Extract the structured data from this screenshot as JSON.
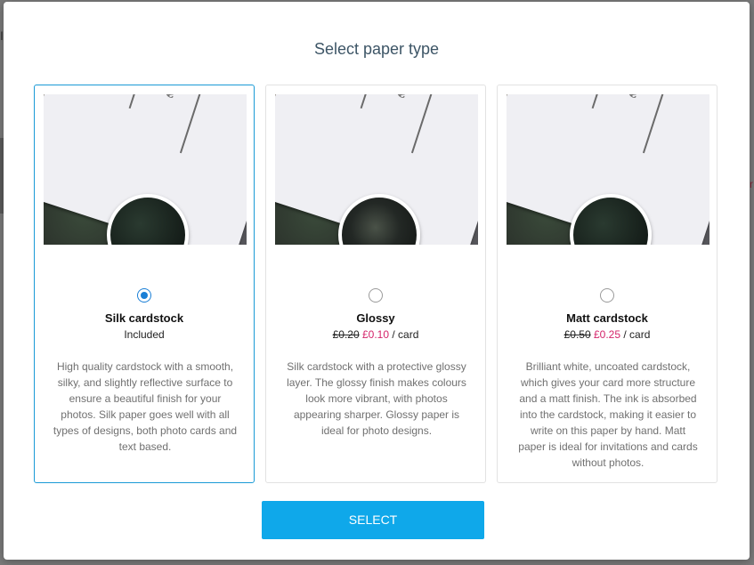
{
  "modal": {
    "title": "Select paper type",
    "select_label": "SELECT"
  },
  "options": [
    {
      "name": "Silk cardstock",
      "price_text": "Included",
      "old_price": "",
      "new_price": "",
      "unit": "",
      "selected": true,
      "description": "High quality cardstock with a smooth, silky, and slightly reflective surface to ensure a beautiful finish for your photos. Silk paper goes well with all types of designs, both photo cards and text based."
    },
    {
      "name": "Glossy",
      "price_text": "",
      "old_price": "£0.20",
      "new_price": "£0.10",
      "unit": "/ card",
      "selected": false,
      "description": "Silk cardstock with a protective glossy layer. The glossy finish makes colours look more vibrant, with photos appearing sharper. Glossy paper is ideal for photo designs."
    },
    {
      "name": "Matt cardstock",
      "price_text": "",
      "old_price": "£0.50",
      "new_price": "£0.25",
      "unit": "/ card",
      "selected": false,
      "description": "Brilliant white, uncoated cardstock, which gives your card more structure and a matt finish. The ink is absorbed into the cardstock, making it easier to write on this paper by hand. Matt paper is ideal for invitations and cards without photos."
    }
  ],
  "colors": {
    "accent": "#0fa8ea",
    "selected_border": "#1a9ad6",
    "sale_price": "#d4246a"
  }
}
